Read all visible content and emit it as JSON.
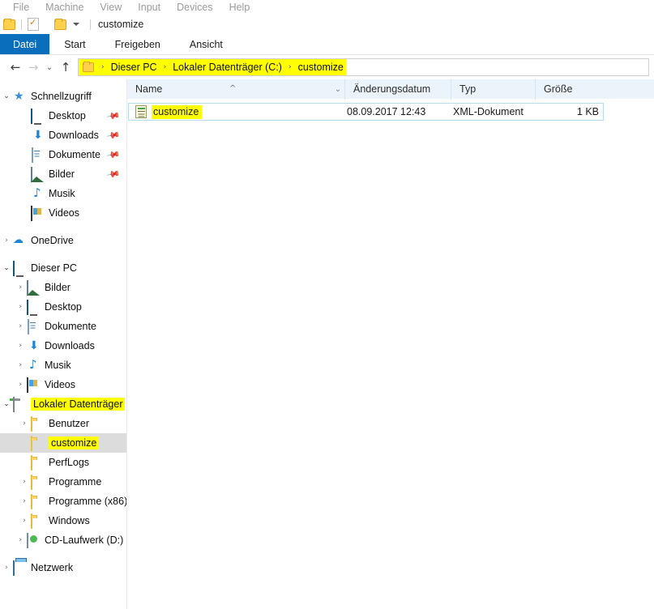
{
  "vbox_menu": {
    "items": [
      "File",
      "Machine",
      "View",
      "Input",
      "Devices",
      "Help"
    ]
  },
  "titlebar": {
    "title": "customize",
    "qat_folder_icon": "folder-icon",
    "qat_properties_icon": "properties-icon",
    "qat_newfolder_icon": "new-folder-icon",
    "qat_dropdown_icon": "chevron-down-icon"
  },
  "ribbon": {
    "tabs": [
      {
        "label": "Datei",
        "selected": true
      },
      {
        "label": "Start",
        "selected": false
      },
      {
        "label": "Freigeben",
        "selected": false
      },
      {
        "label": "Ansicht",
        "selected": false
      }
    ]
  },
  "navigation": {
    "back_icon": "arrow-left-icon",
    "forward_icon": "arrow-right-icon",
    "recent_icon": "chevron-down-icon",
    "up_icon": "arrow-up-icon",
    "address": {
      "folder_icon": "folder-icon",
      "separator": "›",
      "crumbs": [
        "Dieser PC",
        "Lokaler Datenträger (C:)",
        "customize"
      ],
      "highlighted": true,
      "highlight_color": "#ffff00"
    }
  },
  "sidebar": {
    "groups": [
      {
        "items": [
          {
            "label": "Schnellzugriff",
            "icon": "star-icon",
            "chevron": "open",
            "indent": 0,
            "pinned": false
          },
          {
            "label": "Desktop",
            "icon": "monitor-icon",
            "chevron": "none",
            "indent": 1,
            "pinned": true
          },
          {
            "label": "Downloads",
            "icon": "download-arrow-icon",
            "chevron": "none",
            "indent": 1,
            "pinned": true
          },
          {
            "label": "Dokumente",
            "icon": "document-icon",
            "chevron": "none",
            "indent": 1,
            "pinned": true
          },
          {
            "label": "Bilder",
            "icon": "picture-icon",
            "chevron": "none",
            "indent": 1,
            "pinned": true
          },
          {
            "label": "Musik",
            "icon": "music-note-icon",
            "chevron": "none",
            "indent": 1,
            "pinned": false
          },
          {
            "label": "Videos",
            "icon": "video-icon",
            "chevron": "none",
            "indent": 1,
            "pinned": false
          }
        ]
      },
      {
        "items": [
          {
            "label": "OneDrive",
            "icon": "cloud-icon",
            "chevron": "closed",
            "indent": 0,
            "pinned": false
          }
        ]
      },
      {
        "items": [
          {
            "label": "Dieser PC",
            "icon": "monitor-icon",
            "chevron": "open",
            "indent": 0,
            "pinned": false
          },
          {
            "label": "Bilder",
            "icon": "picture-icon",
            "chevron": "closed",
            "indent": 1,
            "pinned": false
          },
          {
            "label": "Desktop",
            "icon": "monitor-icon",
            "chevron": "closed",
            "indent": 1,
            "pinned": false
          },
          {
            "label": "Dokumente",
            "icon": "document-icon",
            "chevron": "closed",
            "indent": 1,
            "pinned": false
          },
          {
            "label": "Downloads",
            "icon": "download-arrow-icon",
            "chevron": "closed",
            "indent": 1,
            "pinned": false
          },
          {
            "label": "Musik",
            "icon": "music-note-icon",
            "chevron": "closed",
            "indent": 1,
            "pinned": false
          },
          {
            "label": "Videos",
            "icon": "video-icon",
            "chevron": "closed",
            "indent": 1,
            "pinned": false
          },
          {
            "label": "Lokaler Datenträger",
            "icon": "drive-icon",
            "chevron": "open",
            "indent": 1,
            "pinned": false,
            "highlighted": true
          },
          {
            "label": "Benutzer",
            "icon": "folder-icon",
            "chevron": "closed",
            "indent": 2,
            "pinned": false
          },
          {
            "label": "customize",
            "icon": "folder-icon",
            "chevron": "none",
            "indent": 2,
            "pinned": false,
            "highlighted": true,
            "selected": true
          },
          {
            "label": "PerfLogs",
            "icon": "folder-icon",
            "chevron": "none",
            "indent": 2,
            "pinned": false
          },
          {
            "label": "Programme",
            "icon": "folder-icon",
            "chevron": "closed",
            "indent": 2,
            "pinned": false
          },
          {
            "label": "Programme (x86)",
            "icon": "folder-icon",
            "chevron": "closed",
            "indent": 2,
            "pinned": false
          },
          {
            "label": "Windows",
            "icon": "folder-icon",
            "chevron": "closed",
            "indent": 2,
            "pinned": false
          },
          {
            "label": "CD-Laufwerk (D:) ES",
            "icon": "cd-drive-icon",
            "chevron": "closed",
            "indent": 1,
            "pinned": false
          }
        ]
      },
      {
        "items": [
          {
            "label": "Netzwerk",
            "icon": "network-icon",
            "chevron": "closed",
            "indent": 0,
            "pinned": false
          }
        ]
      }
    ]
  },
  "filelist": {
    "columns": [
      {
        "key": "name",
        "label": "Name",
        "sorted": "asc"
      },
      {
        "key": "date",
        "label": "Änderungsdatum"
      },
      {
        "key": "type",
        "label": "Typ"
      },
      {
        "key": "size",
        "label": "Größe"
      }
    ],
    "sort_arrow_icon": "sort-ascending-icon",
    "name_dropdown_icon": "chevron-down-icon",
    "rows": [
      {
        "name": "customize",
        "icon": "xml-document-icon",
        "date": "08.09.2017 12:43",
        "type": "XML-Dokument",
        "size": "1 KB",
        "selected": true,
        "highlighted": true
      }
    ]
  },
  "colors": {
    "ribbon_active": "#0b6ebd",
    "highlight": "#ffff00",
    "header_bg": "#ecf4fb",
    "selection_gray": "#dcdcdc",
    "row_border": "#b8dcf0"
  }
}
